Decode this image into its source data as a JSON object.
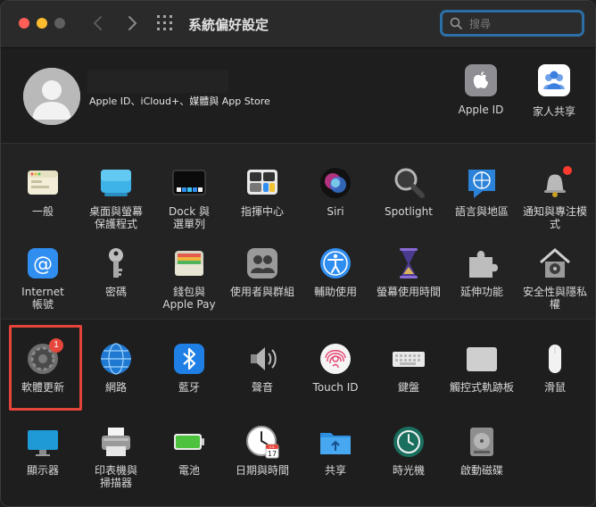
{
  "window": {
    "title": "系統偏好設定"
  },
  "search": {
    "placeholder": "搜尋"
  },
  "account": {
    "subtitle": "Apple ID、iCloud+、媒體與 App Store",
    "top_items": [
      {
        "label": "Apple ID",
        "icon": "apple-id-icon"
      },
      {
        "label": "家人共享",
        "icon": "family-sharing-icon"
      }
    ]
  },
  "panes": {
    "row1": [
      {
        "label": "一般"
      },
      {
        "label": "桌面與螢幕\n保護程式"
      },
      {
        "label": "Dock 與\n選單列"
      },
      {
        "label": "指揮中心"
      },
      {
        "label": "Siri"
      },
      {
        "label": "Spotlight"
      },
      {
        "label": "語言與地區"
      },
      {
        "label": "通知與專注模式"
      }
    ],
    "row2": [
      {
        "label": "Internet\n帳號"
      },
      {
        "label": "密碼"
      },
      {
        "label": "錢包與\nApple Pay"
      },
      {
        "label": "使用者與群組"
      },
      {
        "label": "輔助使用"
      },
      {
        "label": "螢幕使用時間"
      },
      {
        "label": "延伸功能"
      },
      {
        "label": "安全性與隱私權"
      }
    ],
    "row3": [
      {
        "label": "軟體更新",
        "badge": "1"
      },
      {
        "label": "網路"
      },
      {
        "label": "藍牙"
      },
      {
        "label": "聲音"
      },
      {
        "label": "Touch ID"
      },
      {
        "label": "鍵盤"
      },
      {
        "label": "觸控式軌跡板"
      },
      {
        "label": "滑鼠"
      }
    ],
    "row4": [
      {
        "label": "顯示器"
      },
      {
        "label": "印表機與\n掃描器"
      },
      {
        "label": "電池"
      },
      {
        "label": "日期與時間"
      },
      {
        "label": "共享"
      },
      {
        "label": "時光機"
      },
      {
        "label": "啟動磁碟"
      }
    ]
  },
  "date_icon": {
    "month": "JUL",
    "day": "17"
  }
}
